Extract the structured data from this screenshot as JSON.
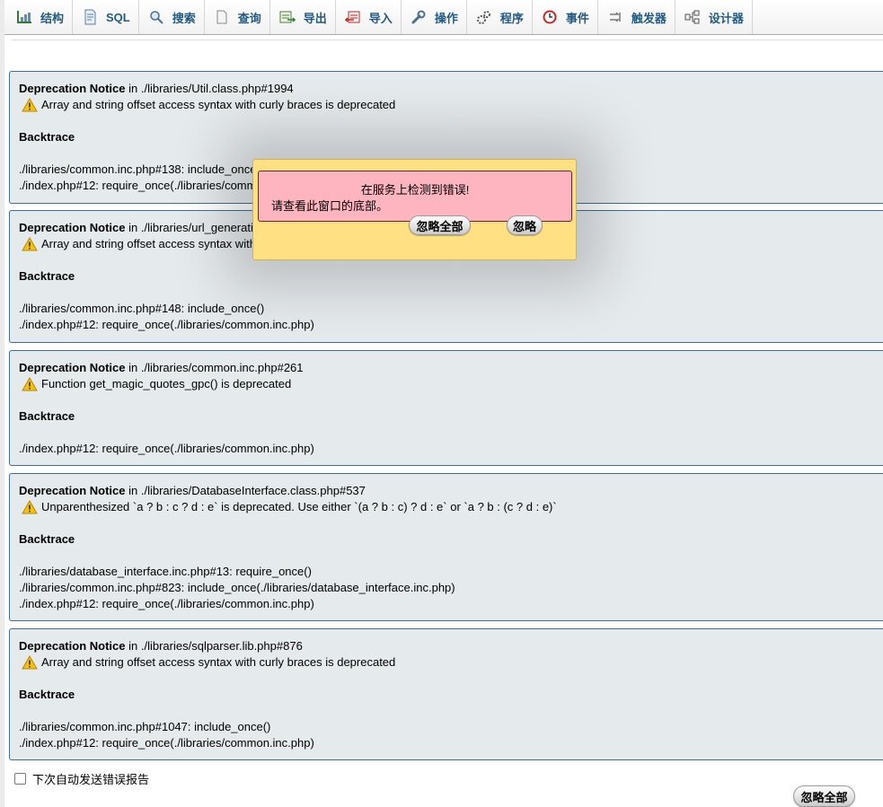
{
  "tabs": [
    {
      "label": "结构",
      "icon": "structure-icon"
    },
    {
      "label": "SQL",
      "icon": "sql-icon"
    },
    {
      "label": "搜索",
      "icon": "search-icon"
    },
    {
      "label": "查询",
      "icon": "query-icon"
    },
    {
      "label": "导出",
      "icon": "export-icon"
    },
    {
      "label": "导入",
      "icon": "import-icon"
    },
    {
      "label": "操作",
      "icon": "wrench-icon"
    },
    {
      "label": "程序",
      "icon": "routines-icon"
    },
    {
      "label": "事件",
      "icon": "events-icon"
    },
    {
      "label": "触发器",
      "icon": "triggers-icon"
    },
    {
      "label": "设计器",
      "icon": "designer-icon"
    }
  ],
  "notices": [
    {
      "type": "Deprecation Notice",
      "in": "in",
      "file": "./libraries/Util.class.php#1994",
      "message": "Array and string offset access syntax with curly braces is deprecated",
      "backtrace_label": "Backtrace",
      "trace": [
        "./libraries/common.inc.php#138: include_once()",
        "./index.php#12: require_once(./libraries/common.inc.php)"
      ]
    },
    {
      "type": "Deprecation Notice",
      "in": "in",
      "file": "./libraries/url_generating.lib.php#78",
      "message": "Array and string offset access syntax with curly braces is deprecated",
      "backtrace_label": "Backtrace",
      "trace": [
        "./libraries/common.inc.php#148: include_once()",
        "./index.php#12: require_once(./libraries/common.inc.php)"
      ]
    },
    {
      "type": "Deprecation Notice",
      "in": "in",
      "file": "./libraries/common.inc.php#261",
      "message": "Function get_magic_quotes_gpc() is deprecated",
      "backtrace_label": "Backtrace",
      "trace": [
        "./index.php#12: require_once(./libraries/common.inc.php)"
      ]
    },
    {
      "type": "Deprecation Notice",
      "in": "in",
      "file": "./libraries/DatabaseInterface.class.php#537",
      "message": "Unparenthesized `a ? b : c ? d : e` is deprecated. Use either `(a ? b : c) ? d : e` or `a ? b : (c ? d : e)`",
      "backtrace_label": "Backtrace",
      "trace": [
        "./libraries/database_interface.inc.php#13: require_once()",
        "./libraries/common.inc.php#823: include_once(./libraries/database_interface.inc.php)",
        "./index.php#12: require_once(./libraries/common.inc.php)"
      ]
    },
    {
      "type": "Deprecation Notice",
      "in": "in",
      "file": "./libraries/sqlparser.lib.php#876",
      "message": "Array and string offset access syntax with curly braces is deprecated",
      "backtrace_label": "Backtrace",
      "trace": [
        "./libraries/common.inc.php#1047: include_once()",
        "./index.php#12: require_once(./libraries/common.inc.php)"
      ]
    }
  ],
  "modal": {
    "line1": "在服务上检测到错误!",
    "line2": "请查看此窗口的底部。",
    "ignore_all": "忽略全部",
    "ignore": "忽略"
  },
  "footer": {
    "auto_send_label": "下次自动发送错误报告",
    "ignore_all": "忽略全部"
  },
  "colors": {
    "tab_text": "#235a81",
    "notice_bg": "#e5eaed",
    "notice_border": "#3e6f90",
    "modal_bg": "#ffe082",
    "modal_error_bg": "#ffb5c0",
    "warning_yellow": "#f4c20d"
  }
}
